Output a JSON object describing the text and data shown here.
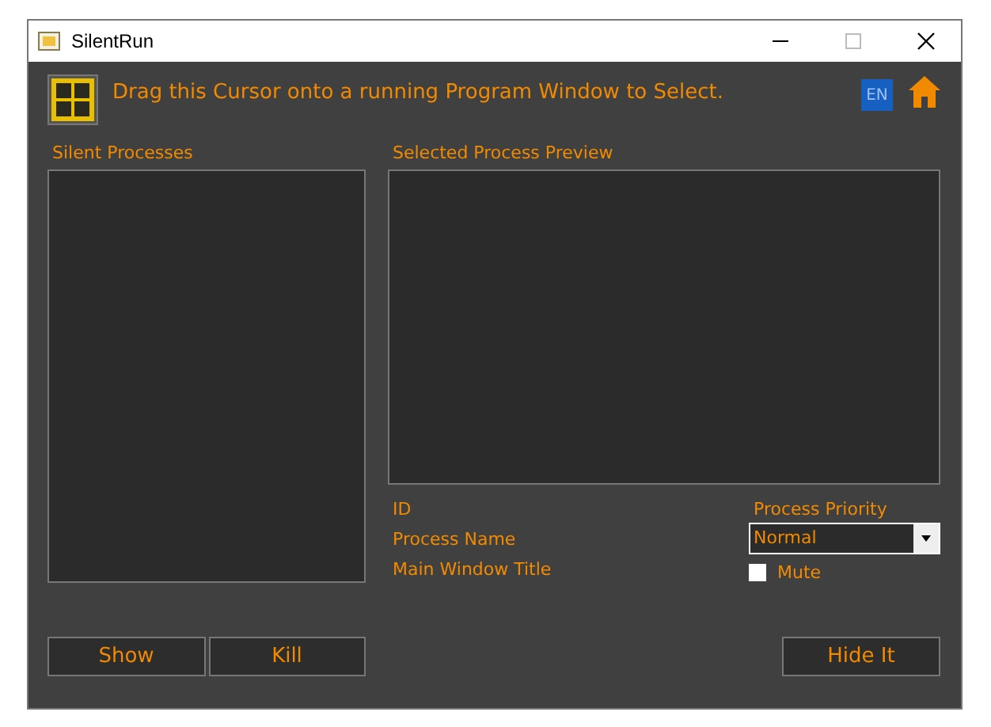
{
  "window": {
    "title": "SilentRun"
  },
  "instruction": "Drag this Cursor onto a running Program Window to Select.",
  "language_badge": "EN",
  "processes": {
    "label": "Silent Processes"
  },
  "preview": {
    "label": "Selected Process Preview"
  },
  "details": [
    "ID",
    "Process Name",
    "Main Window Title"
  ],
  "priority": {
    "label": "Process Priority",
    "value": "Normal"
  },
  "mute": {
    "label": "Mute",
    "checked": false
  },
  "left_buttons": [
    "Show",
    "Kill"
  ],
  "hide_button": "Hide It"
}
